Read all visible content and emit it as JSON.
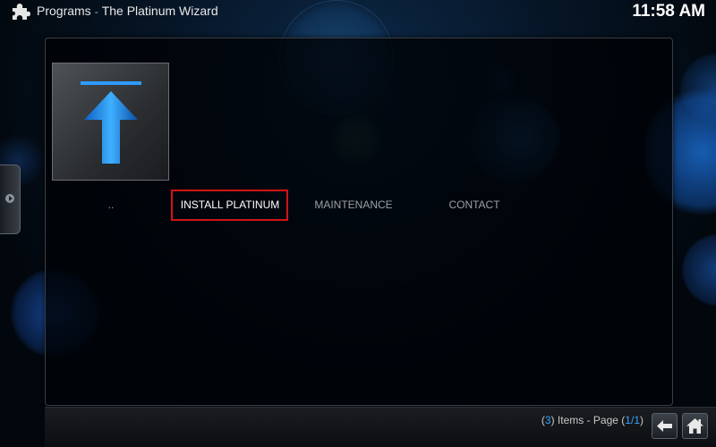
{
  "header": {
    "section": "Programs",
    "separator": "-",
    "addon_title": "The Platinum Wizard",
    "clock": "11:58 AM"
  },
  "icons": {
    "header": "puzzle-icon",
    "thumbnail": "upload-arrow-icon",
    "side_tab": "side-menu-arrow-icon",
    "back": "back-arrow-icon",
    "home": "home-icon"
  },
  "list": {
    "items": [
      {
        "label": "..",
        "selected": false
      },
      {
        "label": "INSTALL PLATINUM",
        "selected": true
      },
      {
        "label": "MAINTENANCE",
        "selected": false
      },
      {
        "label": "CONTACT",
        "selected": false
      }
    ]
  },
  "footer": {
    "items_count_open": "(",
    "items_count": "3",
    "items_count_close": ")",
    "items_label": " Items - Page ",
    "page_open": "(",
    "page_current": "1",
    "page_sep": "/",
    "page_total": "1",
    "page_close": ")"
  },
  "colors": {
    "selection_border": "#d01414",
    "accent_blue": "#3aa3ff",
    "arrow_blue": "#1a8fff"
  }
}
